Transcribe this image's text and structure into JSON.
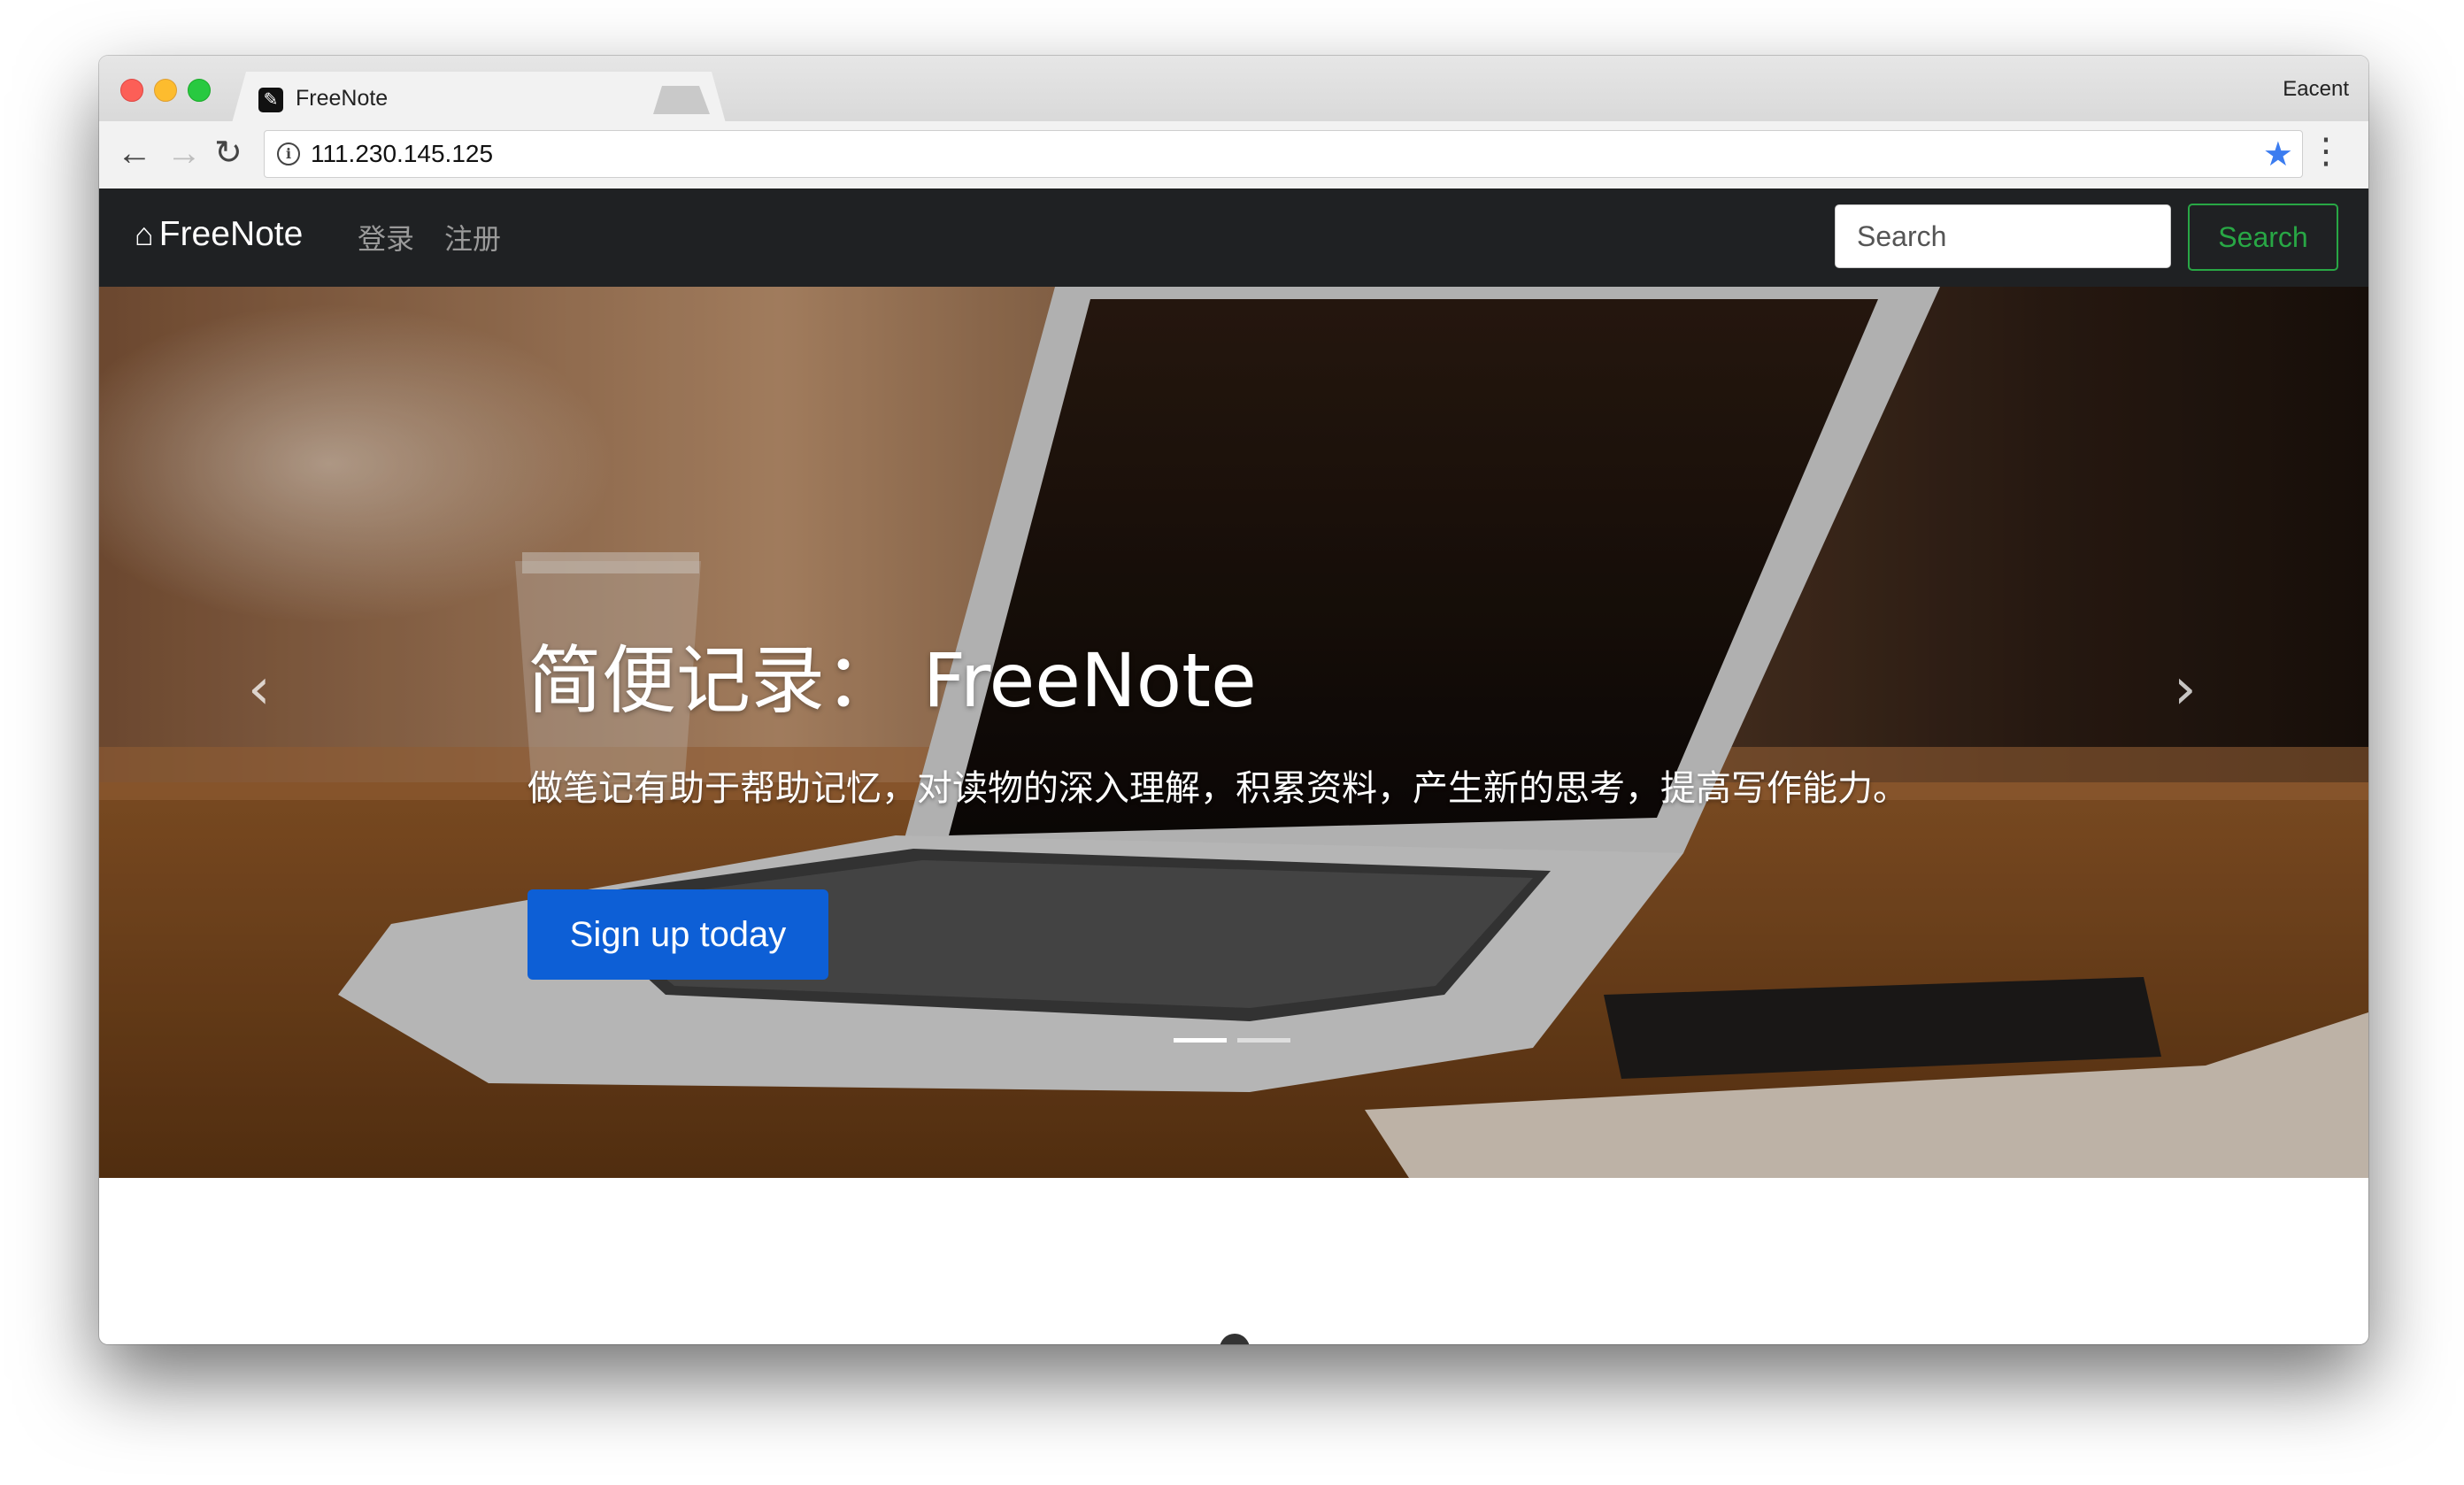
{
  "browser": {
    "tab_title": "FreeNote",
    "tab_close": "×",
    "profile_name": "Eacent",
    "url": "111.230.145.125",
    "icons": {
      "back": "←",
      "forward": "→",
      "reload": "↻",
      "info": "i",
      "bookmark_star": "★",
      "menu": "⋮",
      "favicon": "✎"
    },
    "colors": {
      "close": "#fc5f57",
      "minimize": "#fdbc2e",
      "maximize": "#28c940",
      "star": "#3b7cf0"
    }
  },
  "navbar": {
    "brand_icon": "⌂",
    "brand": "FreeNote",
    "links": [
      "登录",
      "注册"
    ],
    "search_placeholder": "Search",
    "search_button": "Search",
    "colors": {
      "background": "#1f2123",
      "search_button": "#28a745"
    }
  },
  "hero": {
    "title": "简便记录： FreeNote",
    "subtitle": "做笔记有助于帮助记忆，对读物的深入理解，积累资料，产生新的思考，提高写作能力。",
    "cta": "Sign up today",
    "prev_icon": "‹",
    "next_icon": "›",
    "slide_count": 2,
    "active_slide": 1,
    "colors": {
      "cta": "#0d5fd6"
    }
  }
}
